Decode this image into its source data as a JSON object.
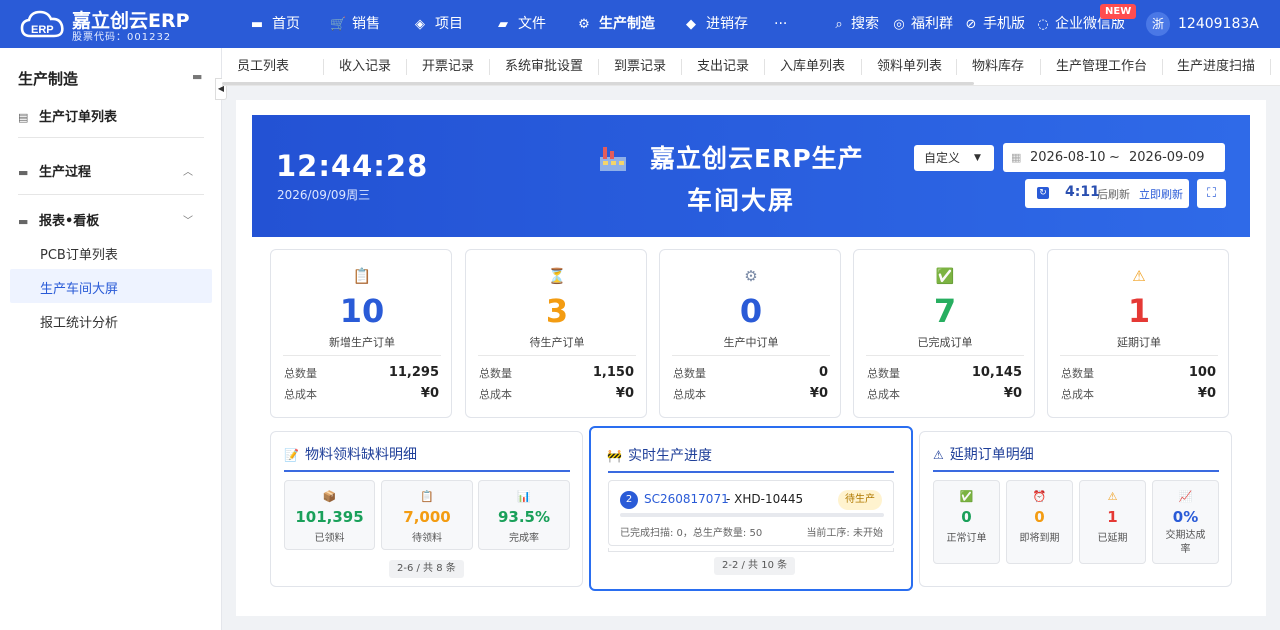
{
  "brand": {
    "name": "嘉立创云ERP",
    "stock_code": "股票代码：001232",
    "logo_text": "ERP"
  },
  "nav": {
    "items": [
      {
        "label": "首页",
        "icon": "monitor-icon"
      },
      {
        "label": "销售",
        "icon": "cart-icon"
      },
      {
        "label": "项目",
        "icon": "layers-icon"
      },
      {
        "label": "文件",
        "icon": "folder-icon"
      },
      {
        "label": "生产制造",
        "icon": "gear-icon",
        "active": true
      },
      {
        "label": "进销存",
        "icon": "box-icon"
      },
      {
        "label": "···",
        "icon": "more-icon"
      }
    ],
    "tools": [
      {
        "label": "搜索",
        "icon": "search-icon"
      },
      {
        "label": "福利群",
        "icon": "wechat-icon"
      },
      {
        "label": "手机版",
        "icon": "link-icon"
      },
      {
        "label": "企业微信版",
        "icon": "enterprise-wechat-icon"
      }
    ],
    "new_badge": "NEW",
    "avatar": "浙",
    "user": "12409183A"
  },
  "sidebar": {
    "title": "生产制造",
    "items": [
      {
        "label": "生产订单列表"
      },
      {
        "label": "生产过程"
      },
      {
        "label": "报表•看板"
      }
    ],
    "subitems": [
      {
        "label": "PCB订单列表"
      },
      {
        "label": "生产车间大屏",
        "active": true
      },
      {
        "label": "报工统计分析"
      }
    ]
  },
  "tabs": [
    "员工列表",
    "收入记录",
    "开票记录",
    "系统审批设置",
    "到票记录",
    "支出记录",
    "入库单列表",
    "领料单列表",
    "物料库存",
    "生产管理工作台",
    "生产进度扫描"
  ],
  "banner": {
    "time": "12:44:28",
    "date": "2026/09/09周三",
    "title_line1": "嘉立创云ERP生产",
    "title_line2": "车间大屏",
    "range_select": "自定义",
    "date_start": "2026-08-10",
    "date_sep": "~",
    "date_end": "2026-09-09",
    "countdown": "4:11",
    "countdown_label": "后刷新",
    "refresh_now": "立即刷新"
  },
  "stat_labels": {
    "total_qty": "总数量",
    "total_cost": "总成本"
  },
  "cards": [
    {
      "icon": "clipboard-icon",
      "emoji": "📋",
      "value": "10",
      "label": "新增生产订单",
      "qty": "11,295",
      "cost": "¥0",
      "color": "#2a5bd7"
    },
    {
      "icon": "hourglass-icon",
      "emoji": "⏳",
      "value": "3",
      "label": "待生产订单",
      "qty": "1,150",
      "cost": "¥0",
      "color": "#f39c12"
    },
    {
      "icon": "gear-icon",
      "emoji": "⚙",
      "value": "0",
      "label": "生产中订单",
      "qty": "0",
      "cost": "¥0",
      "color": "#2a5bd7"
    },
    {
      "icon": "check-icon",
      "emoji": "✅",
      "value": "7",
      "label": "已完成订单",
      "qty": "10,145",
      "cost": "¥0",
      "color": "#27ae60"
    },
    {
      "icon": "warning-icon",
      "emoji": "⚠",
      "value": "1",
      "label": "延期订单",
      "qty": "100",
      "cost": "¥0",
      "color": "#e53935"
    }
  ],
  "material_panel": {
    "title": "物料领料缺料明细",
    "stats": [
      {
        "icon": "package-icon",
        "emoji": "📦",
        "value": "101,395",
        "label": "已领料",
        "color": "#1aa05a"
      },
      {
        "icon": "clipboard-icon",
        "emoji": "📋",
        "value": "7,000",
        "label": "待领料",
        "color": "#f39c12"
      },
      {
        "icon": "chart-icon",
        "emoji": "📊",
        "value": "93.5%",
        "label": "完成率",
        "color": "#1aa05a"
      }
    ],
    "pager": "2-6 / 共 8 条"
  },
  "progress_panel": {
    "title": "实时生产进度",
    "item": {
      "index": "2",
      "order": "SC260817071",
      "code": "- XHD-10445",
      "status": "待生产",
      "progress": 0,
      "detail": "已完成扫描: 0，总生产数量: 50",
      "current": "当前工序: 未开始"
    },
    "pager": "2-2 / 共 10 条"
  },
  "delay_panel": {
    "title": "延期订单明细",
    "stats": [
      {
        "icon": "check-icon",
        "emoji": "✅",
        "value": "0",
        "label": "正常订单",
        "color": "#1aa05a"
      },
      {
        "icon": "alarm-clock-icon",
        "emoji": "⏰",
        "value": "0",
        "label": "即将到期",
        "color": "#f39c12"
      },
      {
        "icon": "warning-icon",
        "emoji": "⚠",
        "value": "1",
        "label": "已延期",
        "color": "#e53935"
      },
      {
        "icon": "trend-chart-icon",
        "emoji": "📈",
        "value": "0%",
        "label": "交期达成率",
        "color": "#2a5bd7"
      }
    ]
  }
}
